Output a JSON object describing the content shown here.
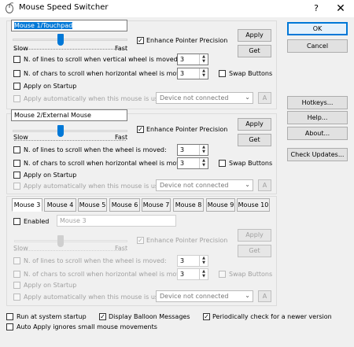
{
  "window": {
    "title": "Mouse Speed Switcher",
    "help": "?",
    "close": "✕"
  },
  "mouse1": {
    "name": "Mouse 1/Touchpad",
    "slow": "Slow",
    "fast": "Fast",
    "enhance": "Enhance Pointer Precision",
    "apply": "Apply",
    "get": "Get",
    "lines_label": "N. of lines to scroll when vertical wheel is moved:",
    "lines_value": "3",
    "chars_label": "N. of chars to scroll when  horizontal wheel is moved:",
    "chars_value": "3",
    "swap": "Swap Buttons",
    "startup": "Apply on Startup",
    "auto_label": "Apply automatically when this mouse is used:",
    "device": "Device not connected",
    "a": "A",
    "speed": 0.43
  },
  "mouse2": {
    "name": "Mouse 2/External Mouse",
    "slow": "Slow",
    "fast": "Fast",
    "enhance": "Enhance Pointer Precision",
    "apply": "Apply",
    "get": "Get",
    "lines_label": "N. of lines to scroll when the wheel is moved:",
    "lines_value": "3",
    "chars_label": "N. of chars to scroll when  horizontal wheel is moved:",
    "chars_value": "3",
    "swap": "Swap Buttons",
    "startup": "Apply on Startup",
    "auto_label": "Apply automatically when this mouse is used:",
    "device": "Device not connected",
    "a": "A",
    "speed": 0.43
  },
  "tabs": [
    "Mouse 3",
    "Mouse 4",
    "Mouse 5",
    "Mouse 6",
    "Mouse 7",
    "Mouse 8",
    "Mouse 9",
    "Mouse 10"
  ],
  "mouse3": {
    "enabled": "Enabled",
    "name": "Mouse 3",
    "slow": "Slow",
    "fast": "Fast",
    "enhance": "Enhance Pointer Precision",
    "apply": "Apply",
    "get": "Get",
    "lines_label": "N. of lines to scroll when the wheel is moved:",
    "lines_value": "3",
    "chars_label": "N. of chars to scroll when  horizontal wheel is moved:",
    "chars_value": "3",
    "swap": "Swap Buttons",
    "startup": "Apply on Startup",
    "auto_label": "Apply automatically when this mouse is used:",
    "device": "Device not connected",
    "a": "A",
    "speed": 0.43
  },
  "side": {
    "ok": "OK",
    "cancel": "Cancel",
    "hotkeys": "Hotkeys...",
    "help": "Help...",
    "about": "About...",
    "updates": "Check Updates..."
  },
  "bottom": {
    "run_startup": "Run at system startup",
    "balloon": "Display Balloon Messages",
    "check_newer": "Periodically check for a newer version",
    "auto_apply": "Auto Apply ignores small mouse movements"
  },
  "icons": {
    "app": "mouse-icon",
    "check": "✓"
  },
  "colors": {
    "accent": "#0078d7",
    "background": "#f0f0f0"
  }
}
